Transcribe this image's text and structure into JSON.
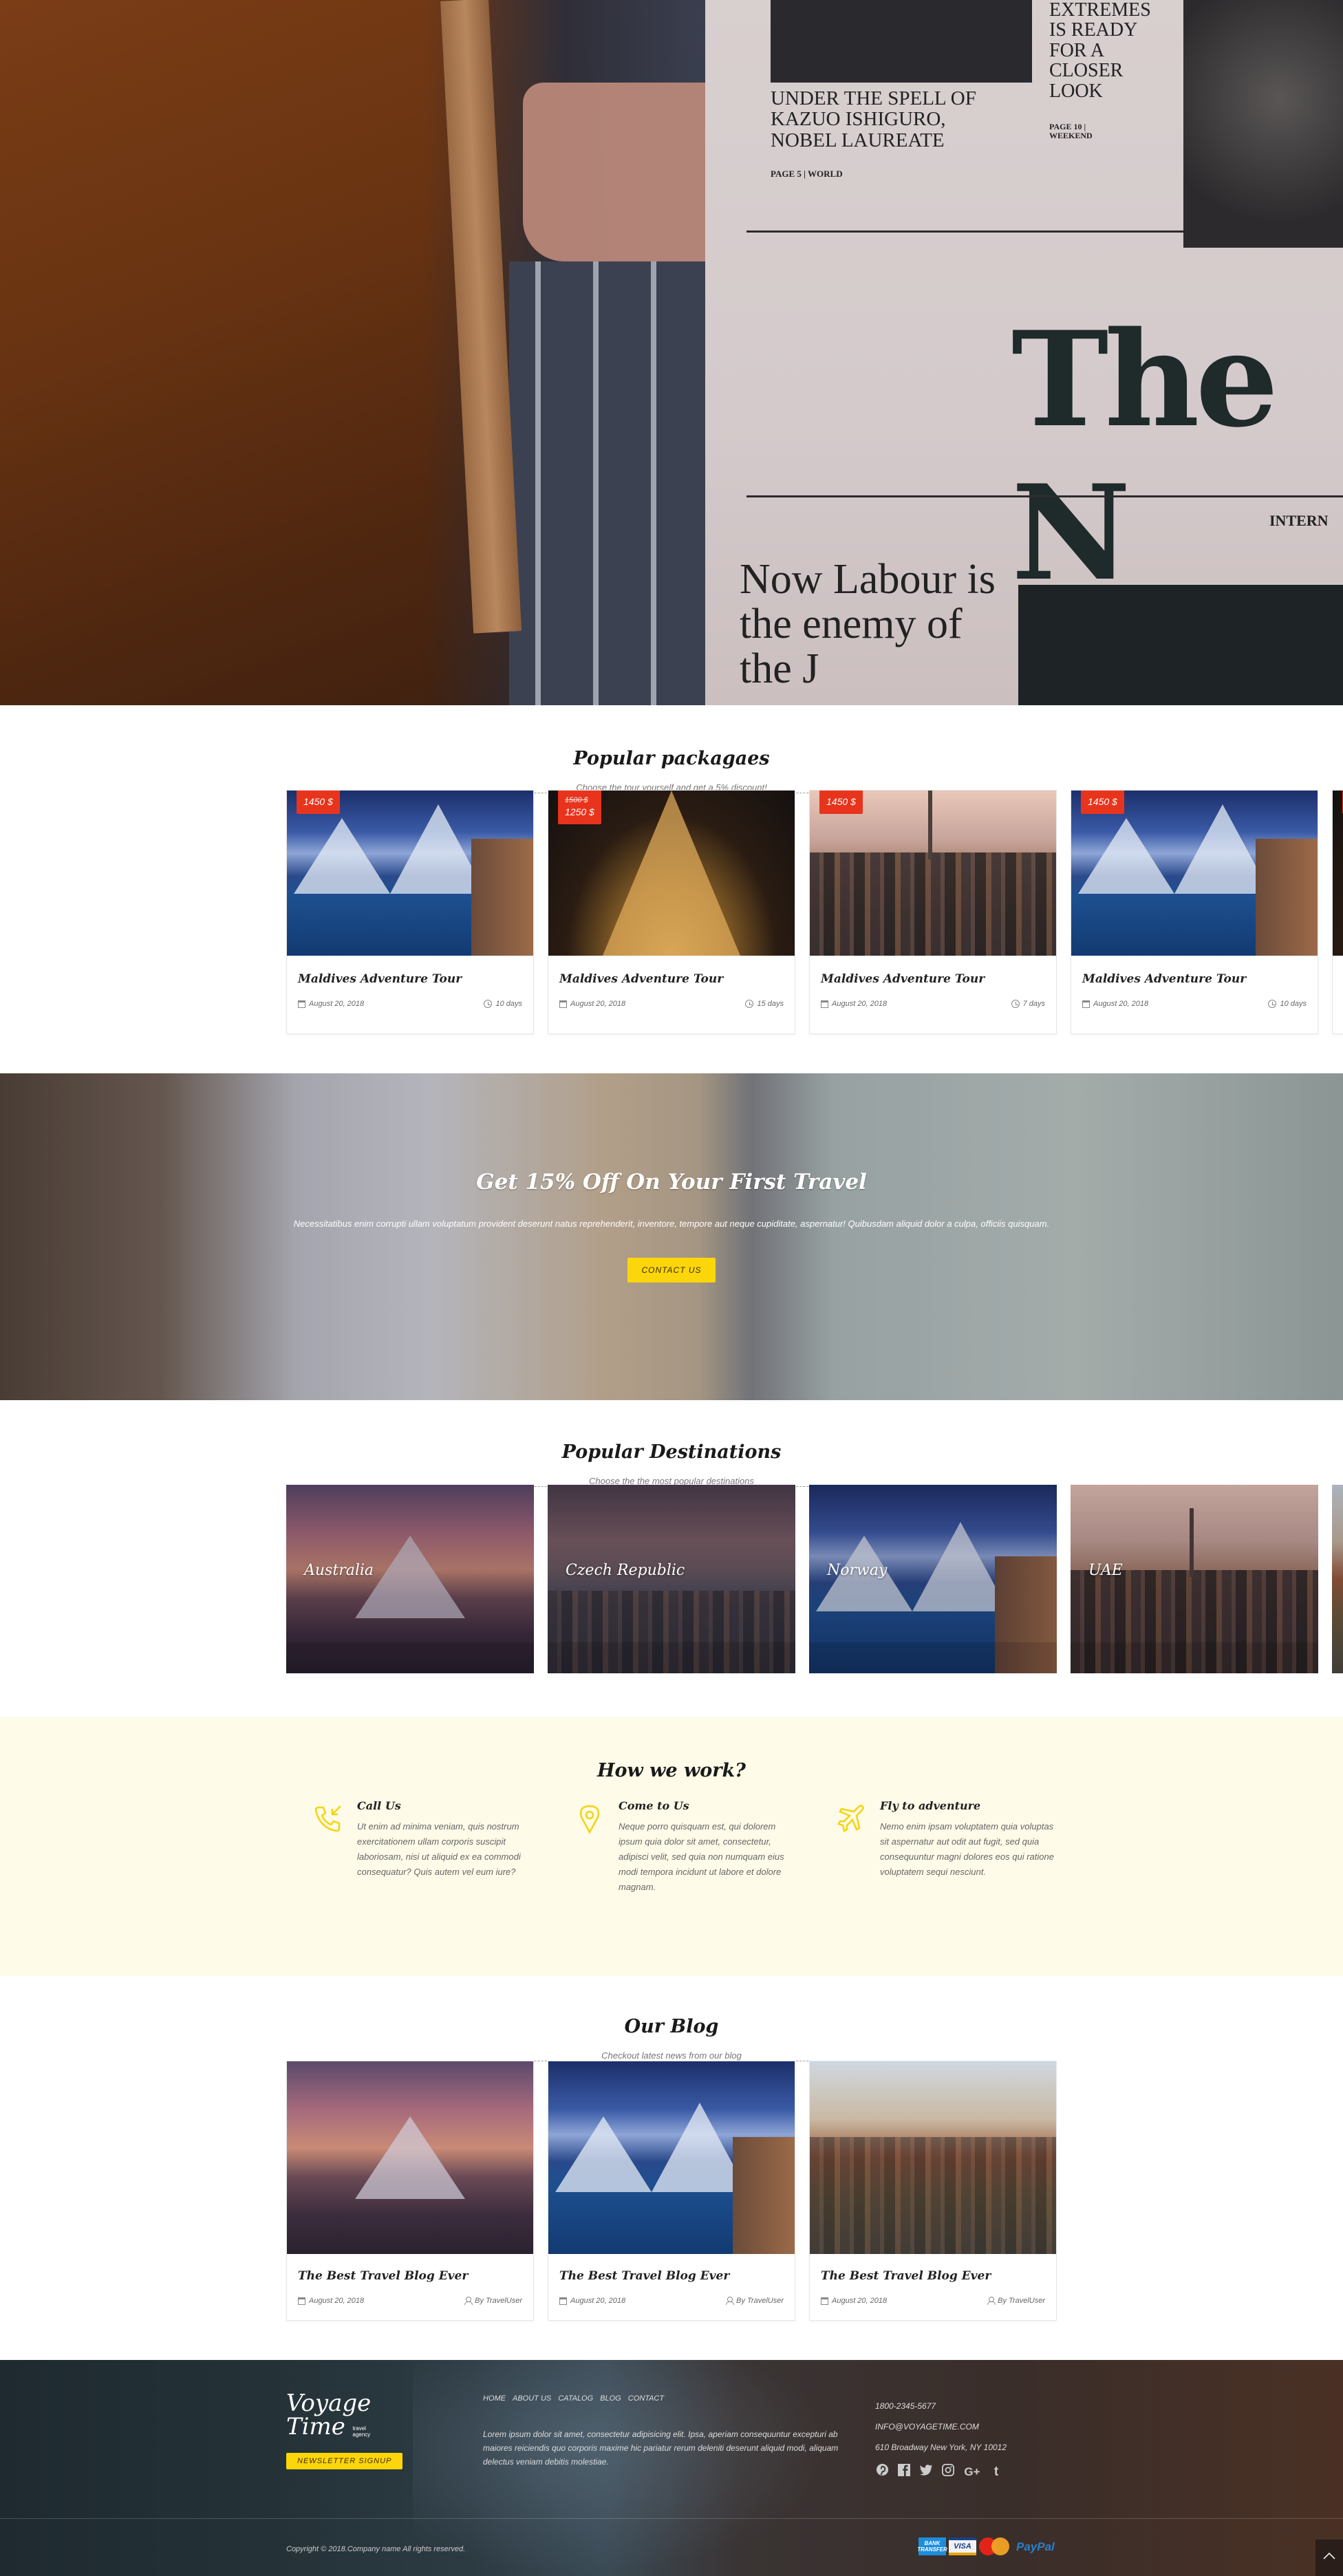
{
  "hero": {
    "image_alt": "Person holding a newspaper",
    "newspaper_lines": {
      "headline_1": "UNDER THE SPELL OF KAZUO ISHIGURO, NOBEL LAUREATE",
      "page_ref_1": "PAGE 5 | WORLD",
      "headline_2": "EXTREMES IS READY FOR A CLOSER LOOK",
      "page_ref_2": "PAGE 10 | WEEKEND",
      "masthead": "The N",
      "section": "INTERN",
      "headline_3": "Now Labour is the enemy of the J"
    }
  },
  "packages": {
    "title": "Popular packagaes",
    "subtitle": "Choose the tour yourself and get a 5% discount!",
    "items": [
      {
        "title": "Maldives Adventure Tour",
        "price": "1450 $",
        "old_price": null,
        "date": "August 20, 2018",
        "duration": "10 days",
        "image": "norway"
      },
      {
        "title": "Maldives Adventure Tour",
        "price": "1250 $",
        "old_price": "1500 $",
        "date": "August 20, 2018",
        "duration": "15 days",
        "image": "paris"
      },
      {
        "title": "Maldives Adventure Tour",
        "price": "1450 $",
        "old_price": null,
        "date": "August 20, 2018",
        "duration": "7 days",
        "image": "dubai"
      },
      {
        "title": "Maldives Adventure Tour",
        "price": "1450 $",
        "old_price": null,
        "date": "August 20, 2018",
        "duration": "10 days",
        "image": "norway"
      }
    ]
  },
  "promo": {
    "title": "Get 15% Off On Your First Travel",
    "text": "Necessitatibus enim corrupti ullam voluptatum provident deserunt natus reprehenderit, inventore, tempore aut neque cupiditate, aspernatur! Quibusdam aliquid dolor a culpa, officiis quisquam.",
    "button": "CONTACT US"
  },
  "destinations": {
    "title": "Popular Destinations",
    "subtitle": "Choose the the most popular destinations",
    "items": [
      {
        "name": "Australia",
        "image": "sydney"
      },
      {
        "name": "Czech Republic",
        "image": "prague"
      },
      {
        "name": "Norway",
        "image": "norway"
      },
      {
        "name": "UAE",
        "image": "dubai"
      }
    ]
  },
  "how": {
    "title": "How we work?",
    "items": [
      {
        "icon": "phone-icon",
        "title": "Call Us",
        "text": "Ut enim ad minima veniam, quis nostrum exercitationem ullam corporis suscipit laboriosam, nisi ut aliquid ex ea commodi consequatur? Quis autem vel eum iure?"
      },
      {
        "icon": "map-pin-icon",
        "title": "Come to Us",
        "text": "Neque porro quisquam est, qui dolorem ipsum quia dolor sit amet, consectetur, adipisci velit, sed quia non numquam eius modi tempora incidunt ut labore et dolore magnam."
      },
      {
        "icon": "airplane-icon",
        "title": "Fly to adventure",
        "text": "Nemo enim ipsam voluptatem quia voluptas sit aspernatur aut odit aut fugit, sed quia consequuntur magni dolores eos qui ratione voluptatem sequi nesciunt."
      }
    ],
    "accent": "#f5d40e"
  },
  "blog": {
    "title": "Our Blog",
    "subtitle": "Checkout latest news from our blog",
    "posts": [
      {
        "title": "The Best Travel Blog Ever",
        "date": "August 20, 2018",
        "author": "By TravelUser",
        "image": "sydney"
      },
      {
        "title": "The Best Travel Blog Ever",
        "date": "August 20, 2018",
        "author": "By TravelUser",
        "image": "norway"
      },
      {
        "title": "The Best Travel Blog Ever",
        "date": "August 20, 2018",
        "author": "By TravelUser",
        "image": "oldtown"
      }
    ]
  },
  "footer": {
    "logo_line1": "Voyage",
    "logo_line2": "Time",
    "logo_tag1": "travel",
    "logo_tag2": "agency",
    "newsletter_button": "NEWSLETTER SIGNUP",
    "nav": [
      "HOME",
      "ABOUT US",
      "CATALOG",
      "BLOG",
      "CONTACT"
    ],
    "about": "Lorem ipsum dolor sit amet, consectetur adipisicing elit. Ipsa, aperiam consequuntur excepturi ab maiores reiciendis quo corporis maxime hic pariatur rerum deleniti deserunt aliquid modi, aliquam delectus veniam debitis molestiae.",
    "phone": "1800-2345-5677",
    "email": "INFO@VOYAGETIME.COM",
    "address": "610 Broadway New York, NY 10012",
    "socials": [
      {
        "icon": "pinterest-icon",
        "glyph": "℗"
      },
      {
        "icon": "facebook-icon",
        "glyph": "f"
      },
      {
        "icon": "twitter-icon",
        "glyph": "🐦"
      },
      {
        "icon": "instagram-icon",
        "glyph": "◎"
      },
      {
        "icon": "google-plus-icon",
        "glyph": "G+"
      },
      {
        "icon": "tumblr-icon",
        "glyph": "t"
      }
    ],
    "copyright": "Copyright © 2018.Company name All rights reserved.",
    "payments": {
      "bank": "BANK TRANSFER",
      "visa": "VISA",
      "mastercard": "MasterCard",
      "paypal": "PayPal"
    },
    "back_to_top": "^",
    "brand_yellow": "#fcd60a",
    "price_red": "#e8341c"
  }
}
